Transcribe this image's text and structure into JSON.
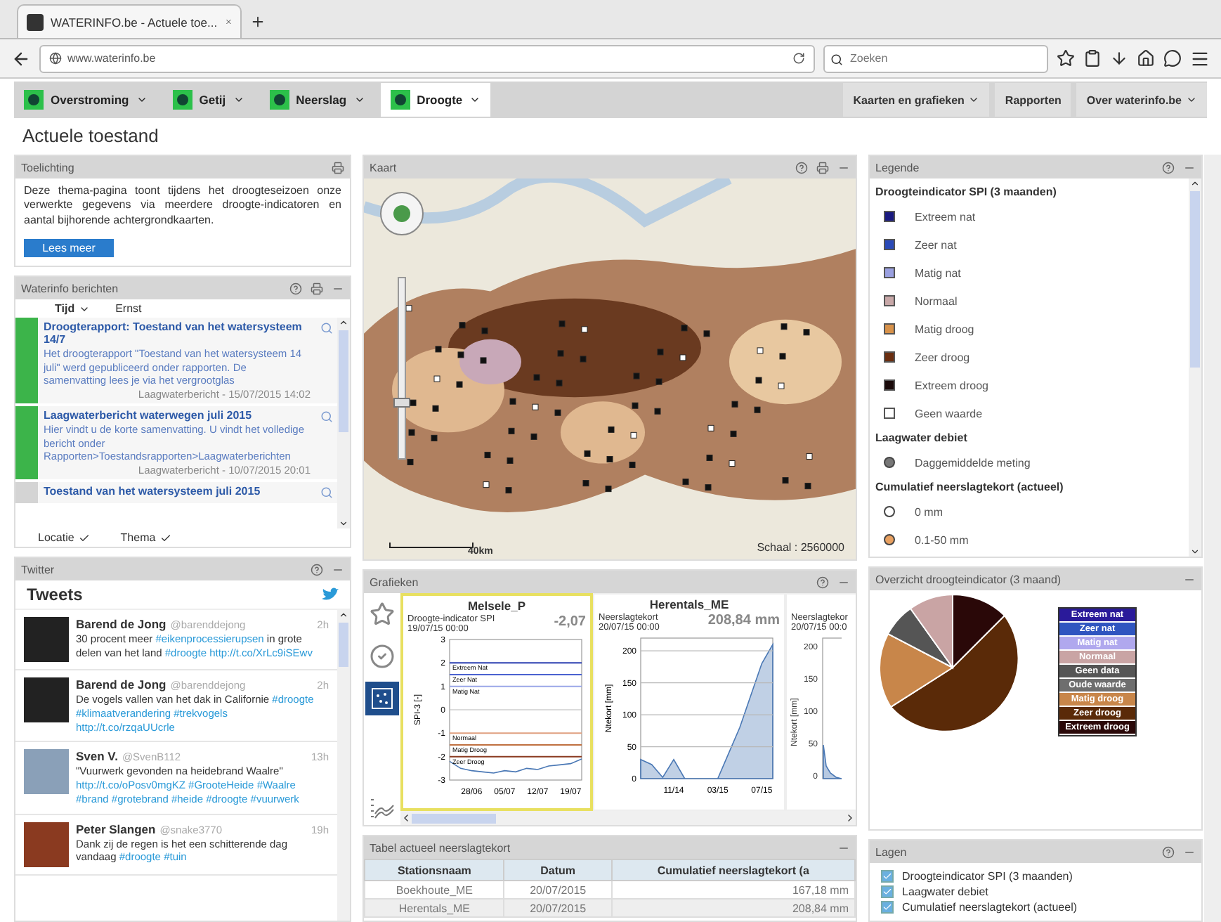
{
  "browser": {
    "tab_title": "WATERINFO.be - Actuele toe...",
    "url": "www.waterinfo.be",
    "search_placeholder": "Zoeken"
  },
  "nav": {
    "themes": [
      {
        "label": "Overstroming",
        "selected": false
      },
      {
        "label": "Getij",
        "selected": false
      },
      {
        "label": "Neerslag",
        "selected": false
      },
      {
        "label": "Droogte",
        "selected": true
      }
    ],
    "links": [
      {
        "label": "Kaarten en grafieken",
        "dropdown": true
      },
      {
        "label": "Rapporten",
        "dropdown": false
      },
      {
        "label": "Over waterinfo.be",
        "dropdown": true
      }
    ]
  },
  "page_title": "Actuele toestand",
  "toelichting": {
    "title": "Toelichting",
    "text": "Deze thema-pagina toont tijdens het droogteseizoen onze verwerkte gegevens via meerdere droogte-indicatoren en aantal bijhorende achtergrondkaarten.",
    "button": "Lees meer"
  },
  "berichten": {
    "title": "Waterinfo berichten",
    "sort": [
      {
        "label": "Tijd",
        "selected": true
      },
      {
        "label": "Ernst",
        "selected": false
      }
    ],
    "items": [
      {
        "title": "Droogterapport: Toestand van het watersysteem 14/7",
        "body": "Het droogterapport \"Toestand van het watersysteem 14 juli\" werd gepubliceerd onder rapporten. De samenvatting lees je via het vergrootglas",
        "meta": "Laagwaterbericht - 15/07/2015 14:02",
        "color": "#3cb44a"
      },
      {
        "title": "Laagwaterbericht waterwegen juli 2015",
        "body": "Hier vindt u de korte samenvatting. U vindt het volledige bericht onder Rapporten>Toestandsrapporten>Laagwaterberichten",
        "meta": "Laagwaterbericht - 10/07/2015 20:01",
        "color": "#3cb44a"
      },
      {
        "title": "Toestand van het watersysteem juli 2015",
        "color": "#d4d4d4"
      }
    ],
    "filters": [
      {
        "label": "Locatie",
        "checked": true
      },
      {
        "label": "Thema",
        "checked": true
      }
    ]
  },
  "twitter": {
    "title": "Twitter",
    "heading": "Tweets",
    "tweets": [
      {
        "name": "Barend de Jong",
        "handle": "@barenddejong",
        "time": "2h",
        "segments": [
          {
            "kind": "plain",
            "text": "30 procent meer "
          },
          {
            "kind": "link",
            "text": "#eikenprocessierupsen"
          },
          {
            "kind": "plain",
            "text": " in grote delen van het land "
          },
          {
            "kind": "link",
            "text": "#droogte http://t.co/XrLc9iSEwv"
          }
        ]
      },
      {
        "name": "Barend de Jong",
        "handle": "@barenddejong",
        "time": "2h",
        "segments": [
          {
            "kind": "plain",
            "text": "De vogels vallen van het dak in Californie "
          },
          {
            "kind": "link",
            "text": "#droogte #klimaatverandering #trekvogels http://t.co/rzqaUUcrle"
          }
        ]
      },
      {
        "name": "Sven V.",
        "handle": "@SvenB112",
        "time": "13h",
        "segments": [
          {
            "kind": "plain",
            "text": "\"Vuurwerk gevonden na heidebrand Waalre\" "
          },
          {
            "kind": "link",
            "text": "http://t.co/oPosv0mgKZ #GrooteHeide #Waalre #brand #grotebrand #heide #droogte #vuurwerk"
          }
        ]
      },
      {
        "name": "Peter Slangen",
        "handle": "@snake3770",
        "time": "19h",
        "segments": [
          {
            "kind": "plain",
            "text": "Dank zij de regen is het een schitterende dag vandaag "
          },
          {
            "kind": "link",
            "text": "#droogte #tuin"
          }
        ]
      }
    ]
  },
  "map": {
    "title": "Kaart",
    "scale": "Schaal : 2560000",
    "scalebar": "40km",
    "zoom": {
      "level": 0.3
    }
  },
  "charts": {
    "title": "Grafieken",
    "items": [
      {
        "station": "Melsele_P",
        "label": "Droogte-indicator SPI",
        "date": "19/07/15 00:00",
        "value": "-2,07",
        "selected": true,
        "chart_data": {
          "type": "line",
          "grid": true,
          "ylabel": "SPI-3 [-]",
          "categories": [
            null,
            null,
            "28/06",
            null,
            null,
            "05/07",
            null,
            null,
            "12/07",
            null,
            null,
            "19/07",
            null
          ],
          "series": [
            {
              "color": "#4a78b5",
              "values": [
                -2.2,
                -2.5,
                -2.6,
                -2.65,
                -2.7,
                -2.6,
                -2.65,
                -2.5,
                -2.55,
                -2.4,
                -2.35,
                -2.3,
                -2.1
              ]
            }
          ],
          "ylim": [
            -3,
            3
          ],
          "yticks": [
            -3,
            -2,
            -1,
            0,
            1,
            2,
            3
          ],
          "ref_lines": [
            {
              "axis": "y",
              "value": 2,
              "label": "Extreem Nat",
              "color": "#2b3fb0"
            },
            {
              "axis": "y",
              "value": 1.5,
              "label": "Zeer Nat",
              "color": "#4a62d0"
            },
            {
              "axis": "y",
              "value": 1,
              "label": "Matig Nat",
              "color": "#9aa6e8"
            },
            {
              "axis": "y",
              "value": -1,
              "label": "Normaal",
              "color": "#e0a080"
            },
            {
              "axis": "y",
              "value": -1.5,
              "label": "Matig Droog",
              "color": "#c07040"
            },
            {
              "axis": "y",
              "value": -2,
              "label": "Zeer Droog",
              "color": "#8a3a20"
            }
          ]
        }
      },
      {
        "station": "Herentals_ME",
        "label": "Neerslagtekort",
        "date": "20/07/15 00:00",
        "value": "208,84 mm",
        "selected": false,
        "chart_data": {
          "type": "area",
          "grid": true,
          "ylabel": "Ntekort [mm]",
          "categories": [
            null,
            null,
            null,
            "11/14",
            null,
            null,
            null,
            "03/15",
            null,
            null,
            null,
            "07/15",
            null
          ],
          "series": [
            {
              "color": "#4a78b5",
              "values": [
                30,
                22,
                2,
                30,
                0,
                0,
                0,
                0,
                40,
                80,
                130,
                180,
                210
              ]
            }
          ],
          "ylim": [
            0,
            220
          ],
          "yticks": [
            0,
            50,
            100,
            150,
            200
          ]
        }
      },
      {
        "label": "Neerslagtekor",
        "date": "20/07/15 00:0",
        "selected": false,
        "axis_title": "Ntekort [mm]",
        "axis_labels": [
          "200",
          "150",
          "100",
          "50",
          "0"
        ]
      }
    ]
  },
  "table": {
    "title": "Tabel actueel neerslagtekort",
    "columns": [
      "Stationsnaam",
      "Datum",
      "Cumulatief neerslagtekort (a"
    ],
    "rows": [
      [
        "Boekhoute_ME",
        "20/07/2015",
        "167,18 mm"
      ],
      [
        "Herentals_ME",
        "20/07/2015",
        "208,84 mm"
      ]
    ]
  },
  "legend": {
    "title": "Legende",
    "sections": [
      {
        "title": "Droogteindicator SPI (3 maanden)",
        "items": [
          {
            "label": "Extreem nat",
            "kind": "square",
            "color": "#1a1a80"
          },
          {
            "label": "Zeer nat",
            "kind": "square",
            "color": "#2a4ab8"
          },
          {
            "label": "Matig nat",
            "kind": "square",
            "color": "#9aa0e0"
          },
          {
            "label": "Normaal",
            "kind": "square",
            "color": "#c8a8a8"
          },
          {
            "label": "Matig droog",
            "kind": "square",
            "color": "#d8924a"
          },
          {
            "label": "Zeer droog",
            "kind": "square",
            "color": "#6a2e10"
          },
          {
            "label": "Extreem droog",
            "kind": "square",
            "color": "#1a0a0a"
          },
          {
            "label": "Geen waarde",
            "kind": "square",
            "color": "#ffffff"
          }
        ]
      },
      {
        "title": "Laagwater debiet",
        "items": [
          {
            "label": "Daggemiddelde meting",
            "kind": "dot",
            "color": "#777777"
          }
        ]
      },
      {
        "title": "Cumulatief neerslagtekort (actueel)",
        "items": [
          {
            "label": "0 mm",
            "kind": "ring",
            "color": "#ffffff"
          },
          {
            "label": "0.1-50 mm",
            "kind": "ring",
            "color": "#e8a060"
          }
        ]
      }
    ]
  },
  "overview": {
    "title": "Overzicht droogteindicator (3 maand)",
    "legend": [
      {
        "label": "Extreem nat",
        "color": "#2a1a9a"
      },
      {
        "label": "Zeer nat",
        "color": "#2f55c0"
      },
      {
        "label": "Matig nat",
        "color": "#b0a8ee"
      },
      {
        "label": "Normaal",
        "color": "#c9a4a4"
      },
      {
        "label": "Geen data",
        "color": "#555555"
      },
      {
        "label": "Oude waarde",
        "color": "#6e6e6e"
      },
      {
        "label": "Matig droog",
        "color": "#c8864a"
      },
      {
        "label": "Zeer droog",
        "color": "#5a2a08"
      },
      {
        "label": "Extreem droog",
        "color": "#2a0808"
      }
    ]
  },
  "layers": {
    "title": "Lagen",
    "items": [
      {
        "label": "Droogteindicator SPI (3 maanden)",
        "checked": true
      },
      {
        "label": "Laagwater debiet",
        "checked": true
      },
      {
        "label": "Cumulatief neerslagtekort (actueel)",
        "checked": true
      }
    ]
  }
}
